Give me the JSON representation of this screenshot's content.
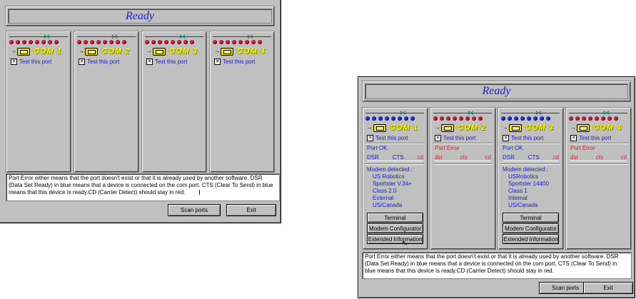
{
  "status_title": "Ready",
  "left_window": {
    "ports": [
      {
        "name": "COM 1",
        "test_label": "Test this port"
      },
      {
        "name": "COM 2",
        "test_label": "Test this port"
      },
      {
        "name": "COM 3",
        "test_label": "Test this port"
      },
      {
        "name": "COM 4",
        "test_label": "Test this port"
      }
    ],
    "info_text": "Port Error either means that the port doesn't exist or that it is already used by another software. DSR (Data Set Ready) in blue means that a device is connected on the com port. CTS (Clear To Send) in blue means that this device is ready.CD (Carrier Detect) should stay in red.",
    "scan_label": "Scan ports",
    "exit_label": "Exit"
  },
  "right_window": {
    "ports": [
      {
        "name": "COM 1",
        "test_label": "Test this port",
        "status": "Port OK",
        "status_color": "#1c1cc8",
        "signals": [
          "DSR",
          "CTS",
          "cd"
        ],
        "signal_colors": [
          "#1c1cc8",
          "#1c1cc8",
          "#c8203c"
        ],
        "modem_label": "Modem detected :",
        "modem_lines": [
          "US Robotics",
          "Sportster V.34+",
          "Class 2.0",
          "External",
          "US/Canada"
        ],
        "buttons": [
          "Terminal",
          "Modem Configurator",
          "Extended Information"
        ]
      },
      {
        "name": "COM 2",
        "test_label": "Test this port",
        "status": "Port Error",
        "status_color": "#c8203c",
        "signals": [
          "dsr",
          "cts",
          "cd"
        ],
        "signal_colors": [
          "#c8203c",
          "#c8203c",
          "#c8203c"
        ]
      },
      {
        "name": "COM 3",
        "test_label": "Test this port",
        "status": "Port OK",
        "status_color": "#1c1cc8",
        "signals": [
          "DSR",
          "CTS",
          "cd"
        ],
        "signal_colors": [
          "#1c1cc8",
          "#1c1cc8",
          "#c8203c"
        ],
        "modem_label": "Modem detected :",
        "modem_lines": [
          "USRobotics",
          "Sportster 14400",
          "Class 1",
          "Internal",
          "US/Canada"
        ],
        "buttons": [
          "Terminal",
          "Modem Configurator",
          "Extended Information"
        ]
      },
      {
        "name": "COM 4",
        "test_label": "Test this port",
        "status": "Port Error",
        "status_color": "#c8203c",
        "signals": [
          "dsr",
          "cts",
          "cd"
        ],
        "signal_colors": [
          "#c8203c",
          "#c8203c",
          "#c8203c"
        ]
      }
    ],
    "info_text": "Port Error either means that the port doesn't exist or that it is already used by another software. DSR (Data Set Ready) in blue means that a device is connected on the com port. CTS (Clear To Send) in blue means that this device is ready.CD (Carrier Detect) should stay in red.",
    "scan_label": "Scan ports",
    "exit_label": "Exit"
  },
  "icons": {
    "bow": "bow-icon",
    "plug": "plug-icon",
    "arrow": "arrow-icon",
    "cursor": "pointer-cursor-icon"
  },
  "colors": {
    "accent_blue": "#1c1cc8",
    "error_red": "#c8203c",
    "com_yellow": "#ffff00",
    "face": "#c0c0c0"
  }
}
